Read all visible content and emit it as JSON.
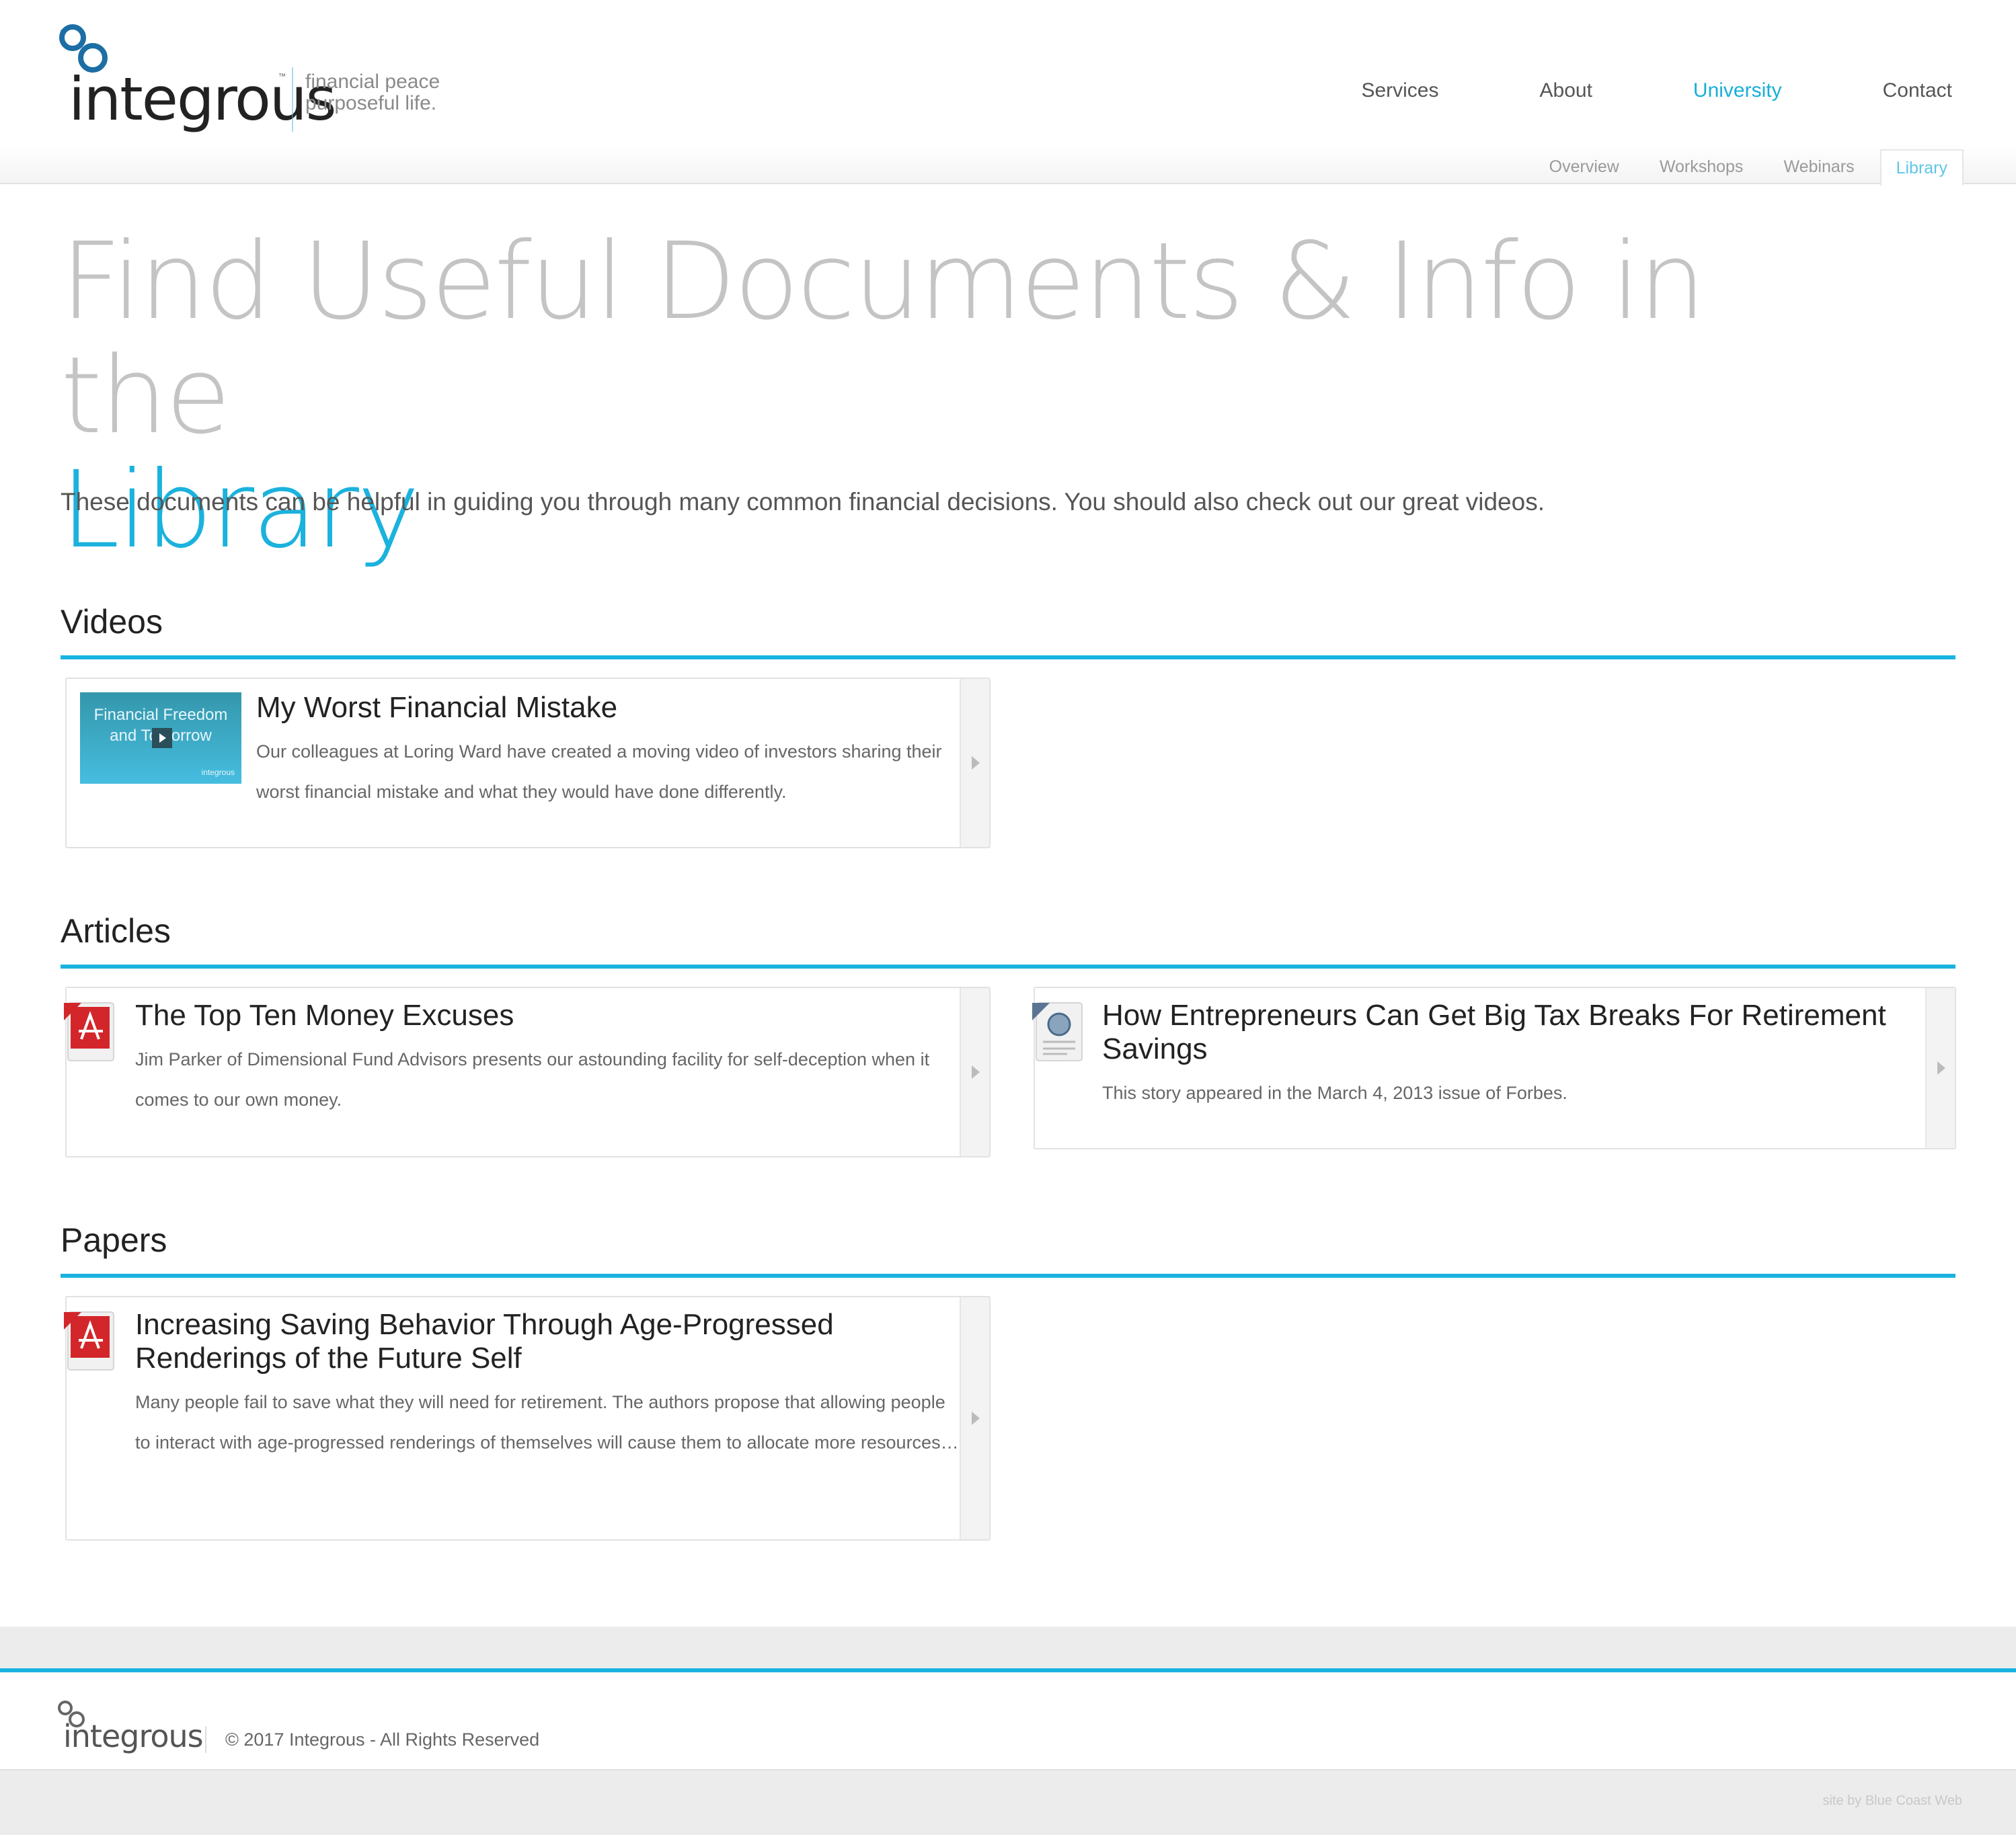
{
  "brand": {
    "name": "integrous",
    "tm": "™",
    "tagline_line1": "financial peace",
    "tagline_line2": "purposeful life."
  },
  "nav": {
    "items": [
      {
        "label": "Services",
        "active": false
      },
      {
        "label": "About",
        "active": false
      },
      {
        "label": "University",
        "active": true
      },
      {
        "label": "Contact",
        "active": false
      }
    ],
    "sub_items": [
      {
        "label": "Overview",
        "active": false
      },
      {
        "label": "Workshops",
        "active": false
      },
      {
        "label": "Webinars",
        "active": false
      },
      {
        "label": "Library",
        "active": true
      }
    ]
  },
  "hero": {
    "title": "Find Useful Documents & Info in the",
    "title_accent": "Library",
    "intro": "These documents can be helpful in guiding you through many common financial decisions. You should also check out our great videos."
  },
  "sections": {
    "videos": {
      "title": "Videos",
      "items": [
        {
          "title": "My Worst Financial Mistake",
          "description": "Our colleagues at Loring Ward have created a moving video of investors sharing their worst financial mistake and what they would have done differently.",
          "thumbnail_text_line1": "Financial Freedom",
          "thumbnail_text_line2": "and To   orrow",
          "thumbnail_brand": "integrous"
        }
      ]
    },
    "articles": {
      "title": "Articles",
      "items": [
        {
          "title": "The Top Ten Money Excuses",
          "description": "Jim Parker of Dimensional Fund Advisors presents our astounding facility for self-deception when it comes to our own money.",
          "icon": "pdf-icon"
        },
        {
          "title": "How Entrepreneurs Can Get Big Tax Breaks For Retirement Savings",
          "description": "This story appeared in the March 4, 2013 issue of Forbes.",
          "icon": "web-document-icon"
        }
      ]
    },
    "papers": {
      "title": "Papers",
      "items": [
        {
          "title": "Increasing Saving Behavior Through Age-Progressed Renderings of the Future Self",
          "description": "Many people fail to save what they will need for retirement. The authors propose that allowing people to interact with age-progressed renderings of themselves will cause them to allocate more resources…",
          "icon": "pdf-icon"
        }
      ]
    }
  },
  "footer": {
    "logo_text": "integrous",
    "copyright": "© 2017 Integrous - All Rights Reserved",
    "credit": "site by Blue Coast Web"
  },
  "colors": {
    "accent": "#1ab3e0",
    "heading_gray": "#c4c4c4",
    "text_dark": "#222222",
    "pdf_red": "#d3262a"
  }
}
